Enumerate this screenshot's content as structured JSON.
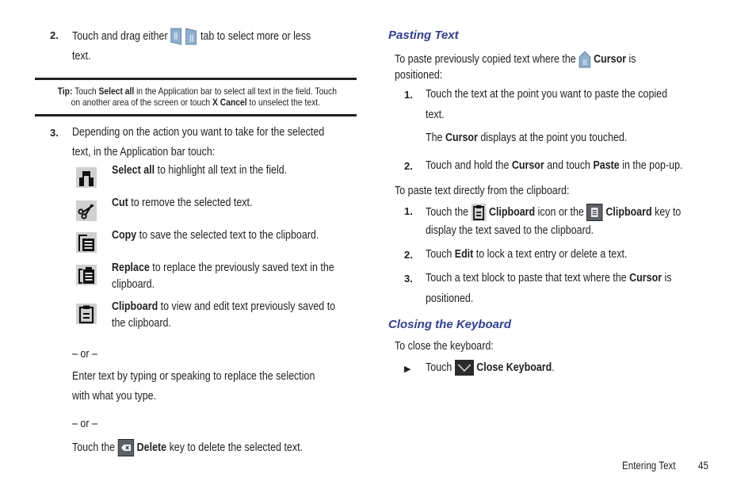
{
  "left": {
    "step2": {
      "num": "2.",
      "pre": "Touch and drag either",
      "post": "tab to select more or less",
      "line2": "text.",
      "icons": [
        "left-selection-tab-icon",
        "right-selection-tab-icon"
      ]
    },
    "tip": {
      "label": "Tip:",
      "t1": "Touch",
      "b1": "Select all",
      "t2": "in the Application bar to select all text in the field. Touch",
      "t3": "on another area of the screen or touch",
      "b2": "X Cancel",
      "t4": "to unselect the text."
    },
    "step3": {
      "num": "3.",
      "line1": "Depending on the action you want to take for the selected",
      "line2": "text, in the Application bar touch:"
    },
    "actions": [
      {
        "icon": "select-all-icon",
        "bold": "Select all",
        "text": "to highlight all text in the field.",
        "text2": ""
      },
      {
        "icon": "cut-icon",
        "bold": "Cut",
        "text": "to remove the selected text.",
        "text2": ""
      },
      {
        "icon": "copy-icon",
        "bold": "Copy",
        "text": "to save the selected text to the clipboard.",
        "text2": ""
      },
      {
        "icon": "replace-icon",
        "bold": "Replace",
        "text": "to replace the previously saved text in the",
        "text2": "clipboard."
      },
      {
        "icon": "clipboard-icon",
        "bold": "Clipboard",
        "text": "to view and edit text previously saved to",
        "text2": "the clipboard."
      }
    ],
    "or1": "– or –",
    "enter_l1": "Enter text by typing or speaking to replace the selection",
    "enter_l2": "with what you type.",
    "or2": "– or –",
    "delete": {
      "pre": "Touch the",
      "bold": "Delete",
      "post": "key to delete the selected text.",
      "icon": "delete-key-icon"
    }
  },
  "right": {
    "pasting_heading": "Pasting Text",
    "intro1": {
      "pre": "To paste previously copied text where the",
      "bold": "Cursor",
      "post": "is",
      "line2": "positioned:",
      "icon": "cursor-icon"
    },
    "p1": {
      "num": "1.",
      "l1": "Touch the text at the point you want to paste the copied",
      "l2": "text.",
      "sub_pre": "The",
      "sub_bold": "Cursor",
      "sub_post": "displays at the point you touched."
    },
    "p2": {
      "num": "2.",
      "t1": "Touch and hold the",
      "b1": "Cursor",
      "t2": "and touch",
      "b2": "Paste",
      "t3": "in the pop-up."
    },
    "intro2": "To paste text directly from the clipboard:",
    "c1": {
      "num": "1.",
      "t1": "Touch the",
      "b1": "Clipboard",
      "t2": "icon or the",
      "b2": "Clipboard",
      "t3": "key to",
      "l2": "display the text saved to the clipboard."
    },
    "c2": {
      "num": "2.",
      "t1": "Touch",
      "b1": "Edit",
      "t2": "to lock a text entry or delete a text."
    },
    "c3": {
      "num": "3.",
      "t1": "Touch a text block to paste that text where the",
      "b1": "Cursor",
      "t2": "is",
      "l2": "positioned."
    },
    "closing_heading": "Closing the Keyboard",
    "close_intro": "To close the keyboard:",
    "close_step": {
      "bullet": "▶",
      "t1": "Touch",
      "b1": "Close Keyboard",
      "t2": "."
    }
  },
  "footer": {
    "section": "Entering Text",
    "page": "45"
  }
}
